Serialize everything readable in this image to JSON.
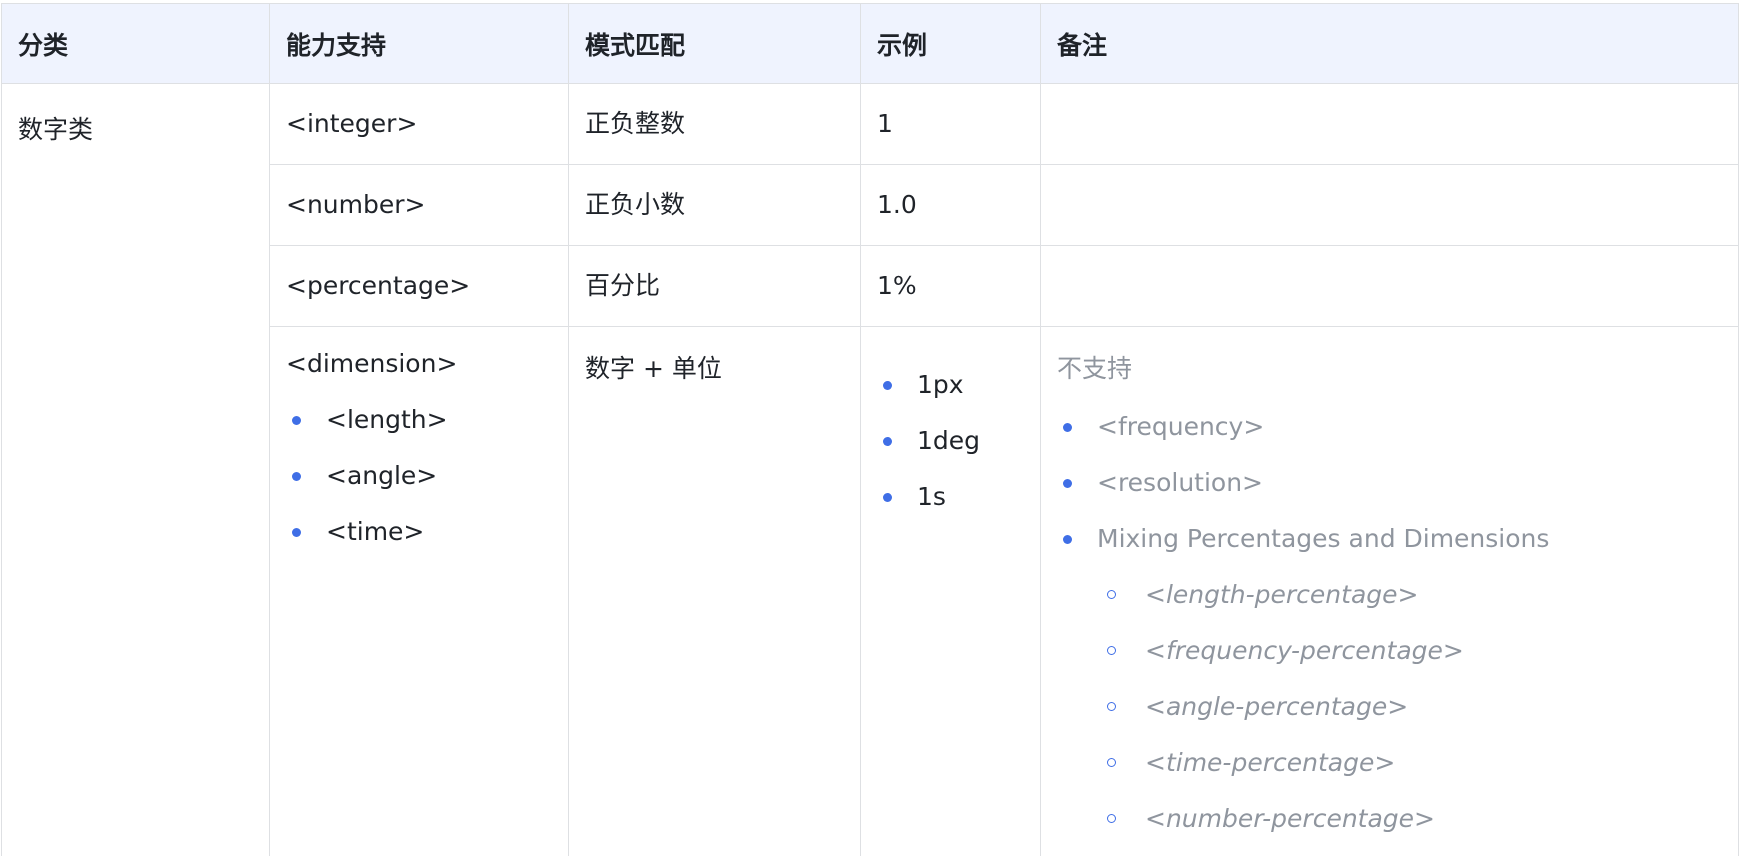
{
  "table": {
    "headers": [
      "分类",
      "能力支持",
      "模式匹配",
      "示例",
      "备注"
    ],
    "category": "数字类",
    "rows": [
      {
        "support": "<integer>",
        "pattern": "正负整数",
        "example": "1",
        "note": ""
      },
      {
        "support": "<number>",
        "pattern": "正负小数",
        "example": "1.0",
        "note": ""
      },
      {
        "support": "<percentage>",
        "pattern": "百分比",
        "example": "1%",
        "note": ""
      }
    ],
    "dimension_row": {
      "support_title": "<dimension>",
      "support_items": [
        "<length>",
        "<angle>",
        "<time>"
      ],
      "pattern": "数字 + 单位",
      "examples": [
        "1px",
        "1deg",
        "1s"
      ],
      "note_title": "不支持",
      "note_items": [
        "<frequency>",
        "<resolution>",
        "Mixing Percentages and Dimensions"
      ],
      "note_subitems": [
        "<length-percentage>",
        "<frequency-percentage>",
        "<angle-percentage>",
        "<time-percentage>",
        "<number-percentage>"
      ]
    }
  },
  "colors": {
    "header_bg": "#eff3fe",
    "border": "#dee0e3",
    "bullet": "#3f6ee6",
    "muted_text": "#8f959e",
    "text": "#1f2329"
  }
}
